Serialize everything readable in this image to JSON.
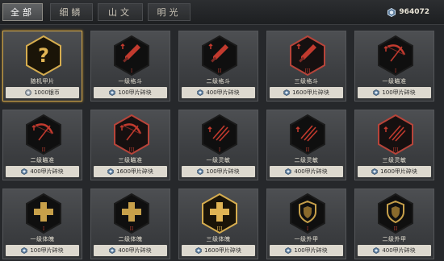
{
  "tabs": [
    {
      "label": "全部",
      "active": true
    },
    {
      "label": "细鳞",
      "active": false
    },
    {
      "label": "山文",
      "active": false
    },
    {
      "label": "明光",
      "active": false
    }
  ],
  "currency": {
    "amount": "964072",
    "icon": "fragment-icon"
  },
  "cards": [
    {
      "name": "随机甲片",
      "price": "1000银币",
      "price_icon": "silver-coin-icon",
      "art": "question",
      "rank": "",
      "frame": "gold",
      "selected": true
    },
    {
      "name": "一级格斗",
      "price": "100甲片碎块",
      "price_icon": "fragment-icon",
      "art": "sword",
      "rank": "I",
      "frame": "dark",
      "selected": false
    },
    {
      "name": "二级格斗",
      "price": "400甲片碎块",
      "price_icon": "fragment-icon",
      "art": "sword",
      "rank": "II",
      "frame": "dark",
      "selected": false
    },
    {
      "name": "三级格斗",
      "price": "1600甲片碎块",
      "price_icon": "fragment-icon",
      "art": "sword",
      "rank": "III",
      "frame": "red",
      "selected": false
    },
    {
      "name": "一级瞄准",
      "price": "100甲片碎块",
      "price_icon": "fragment-icon",
      "art": "bow",
      "rank": "I",
      "frame": "dark",
      "selected": false
    },
    {
      "name": "二级瞄准",
      "price": "400甲片碎块",
      "price_icon": "fragment-icon",
      "art": "bow",
      "rank": "II",
      "frame": "dark",
      "selected": false
    },
    {
      "name": "三级瞄准",
      "price": "1600甲片碎块",
      "price_icon": "fragment-icon",
      "art": "bow",
      "rank": "III",
      "frame": "red",
      "selected": false
    },
    {
      "name": "一级灵敏",
      "price": "100甲片碎块",
      "price_icon": "fragment-icon",
      "art": "claw",
      "rank": "I",
      "frame": "dark",
      "selected": false
    },
    {
      "name": "二级灵敏",
      "price": "400甲片碎块",
      "price_icon": "fragment-icon",
      "art": "claw",
      "rank": "II",
      "frame": "dark",
      "selected": false
    },
    {
      "name": "三级灵敏",
      "price": "1600甲片碎块",
      "price_icon": "fragment-icon",
      "art": "claw",
      "rank": "III",
      "frame": "red",
      "selected": false
    },
    {
      "name": "一级体魄",
      "price": "100甲片碎块",
      "price_icon": "fragment-icon",
      "art": "cross",
      "rank": "I",
      "frame": "dark",
      "selected": false
    },
    {
      "name": "二级体魄",
      "price": "400甲片碎块",
      "price_icon": "fragment-icon",
      "art": "cross",
      "rank": "II",
      "frame": "dark",
      "selected": false
    },
    {
      "name": "三级体魄",
      "price": "1600甲片碎块",
      "price_icon": "fragment-icon",
      "art": "cross",
      "rank": "III",
      "frame": "gold",
      "selected": false
    },
    {
      "name": "一级外甲",
      "price": "100甲片碎块",
      "price_icon": "fragment-icon",
      "art": "shield",
      "rank": "I",
      "frame": "dark",
      "selected": false
    },
    {
      "name": "二级外甲",
      "price": "400甲片碎块",
      "price_icon": "fragment-icon",
      "art": "shield",
      "rank": "II",
      "frame": "dark",
      "selected": false
    }
  ],
  "colors": {
    "gold": "#c9a24b",
    "red_accent": "#b33a2e",
    "dark_hex": "#141414",
    "price_bar": "#ddd9cf"
  }
}
